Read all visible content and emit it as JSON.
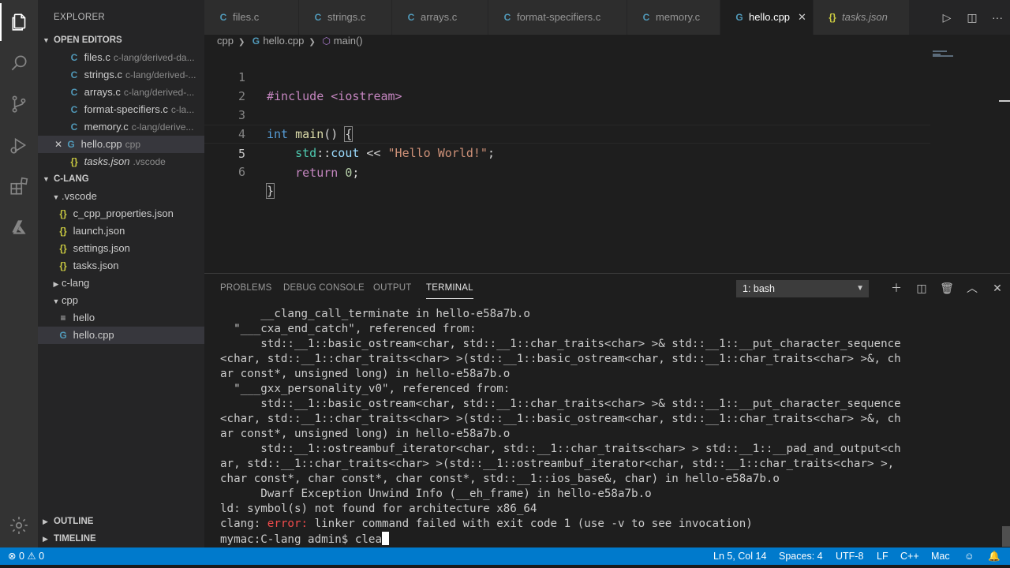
{
  "sidebar": {
    "title": "EXPLORER",
    "open_editors_header": "OPEN EDITORS",
    "open_editors": [
      {
        "icon": "C",
        "name": "files.c",
        "desc": "c-lang/derived-da..."
      },
      {
        "icon": "C",
        "name": "strings.c",
        "desc": "c-lang/derived-..."
      },
      {
        "icon": "C",
        "name": "arrays.c",
        "desc": "c-lang/derived-..."
      },
      {
        "icon": "C",
        "name": "format-specifiers.c",
        "desc": "c-la..."
      },
      {
        "icon": "C",
        "name": "memory.c",
        "desc": "c-lang/derive..."
      },
      {
        "icon": "G",
        "name": "hello.cpp",
        "desc": "cpp",
        "close": "✕"
      },
      {
        "icon": "{}",
        "name": "tasks.json",
        "desc": ".vscode"
      }
    ],
    "folder_header": "C-LANG",
    "tree": [
      {
        "label": ".vscode"
      },
      {
        "icon": "{}",
        "label": "c_cpp_properties.json"
      },
      {
        "icon": "{}",
        "label": "launch.json"
      },
      {
        "icon": "{}",
        "label": "settings.json"
      },
      {
        "icon": "{}",
        "label": "tasks.json"
      },
      {
        "label": "c-lang"
      },
      {
        "label": "cpp"
      },
      {
        "icon": "≡",
        "label": "hello"
      },
      {
        "icon": "G",
        "label": "hello.cpp"
      }
    ],
    "outline_header": "OUTLINE",
    "timeline_header": "TIMELINE"
  },
  "tabs": [
    {
      "icon": "C",
      "label": "files.c"
    },
    {
      "icon": "C",
      "label": "strings.c"
    },
    {
      "icon": "C",
      "label": "arrays.c"
    },
    {
      "icon": "C",
      "label": "format-specifiers.c"
    },
    {
      "icon": "C",
      "label": "memory.c"
    },
    {
      "icon": "G",
      "label": "hello.cpp",
      "close": "✕"
    },
    {
      "icon": "{}",
      "label": "tasks.json"
    }
  ],
  "breadcrumb": {
    "folder": "cpp",
    "file": "hello.cpp",
    "symbol": "main()"
  },
  "editor": {
    "lines": [
      {
        "num": "1",
        "parts": [
          "#include <iostream>"
        ]
      },
      {
        "num": "2",
        "parts": [
          ""
        ]
      },
      {
        "num": "3",
        "parts": [
          "int",
          " ",
          "main",
          "() ",
          "{"
        ]
      },
      {
        "num": "4",
        "parts": [
          "    ",
          "std",
          "::",
          "cout",
          " << ",
          "\"Hello World!\"",
          ";"
        ]
      },
      {
        "num": "5",
        "parts": [
          "    ",
          "return",
          " ",
          "0",
          ";"
        ]
      },
      {
        "num": "6",
        "parts": [
          "}"
        ]
      }
    ]
  },
  "panel": {
    "tabs": [
      "PROBLEMS",
      "DEBUG CONSOLE",
      "OUTPUT",
      "TERMINAL"
    ],
    "terminal_select": "1: bash",
    "terminal_lines": [
      "      __clang_call_terminate in hello-e58a7b.o",
      "  \"___cxa_end_catch\", referenced from:",
      "      std::__1::basic_ostream<char, std::__1::char_traits<char> >& std::__1::__put_character_sequence",
      "<char, std::__1::char_traits<char> >(std::__1::basic_ostream<char, std::__1::char_traits<char> >&, ch",
      "ar const*, unsigned long) in hello-e58a7b.o",
      "  \"___gxx_personality_v0\", referenced from:",
      "      std::__1::basic_ostream<char, std::__1::char_traits<char> >& std::__1::__put_character_sequence",
      "<char, std::__1::char_traits<char> >(std::__1::basic_ostream<char, std::__1::char_traits<char> >&, ch",
      "ar const*, unsigned long) in hello-e58a7b.o",
      "      std::__1::ostreambuf_iterator<char, std::__1::char_traits<char> > std::__1::__pad_and_output<ch",
      "ar, std::__1::char_traits<char> >(std::__1::ostreambuf_iterator<char, std::__1::char_traits<char> >,",
      "char const*, char const*, char const*, std::__1::ios_base&, char) in hello-e58a7b.o",
      "      Dwarf Exception Unwind Info (__eh_frame) in hello-e58a7b.o",
      "ld: symbol(s) not found for architecture x86_64"
    ],
    "error_line": {
      "prefix": "clang: ",
      "error": "error:",
      "rest": " linker command failed with exit code 1 (use -v to see invocation)"
    },
    "prompt": "mymac:C-lang admin$ ",
    "typed": "clea"
  },
  "status": {
    "errors": "0",
    "warnings": "0",
    "position": "Ln 5, Col 14",
    "spaces": "Spaces: 4",
    "encoding": "UTF-8",
    "eol": "LF",
    "language": "C++",
    "platform": "Mac"
  },
  "colors": {
    "status_bar": "#007acc",
    "activity_bar": "#333333",
    "sidebar": "#252526",
    "editor": "#1e1e1e",
    "error_text": "#f14c4c"
  }
}
